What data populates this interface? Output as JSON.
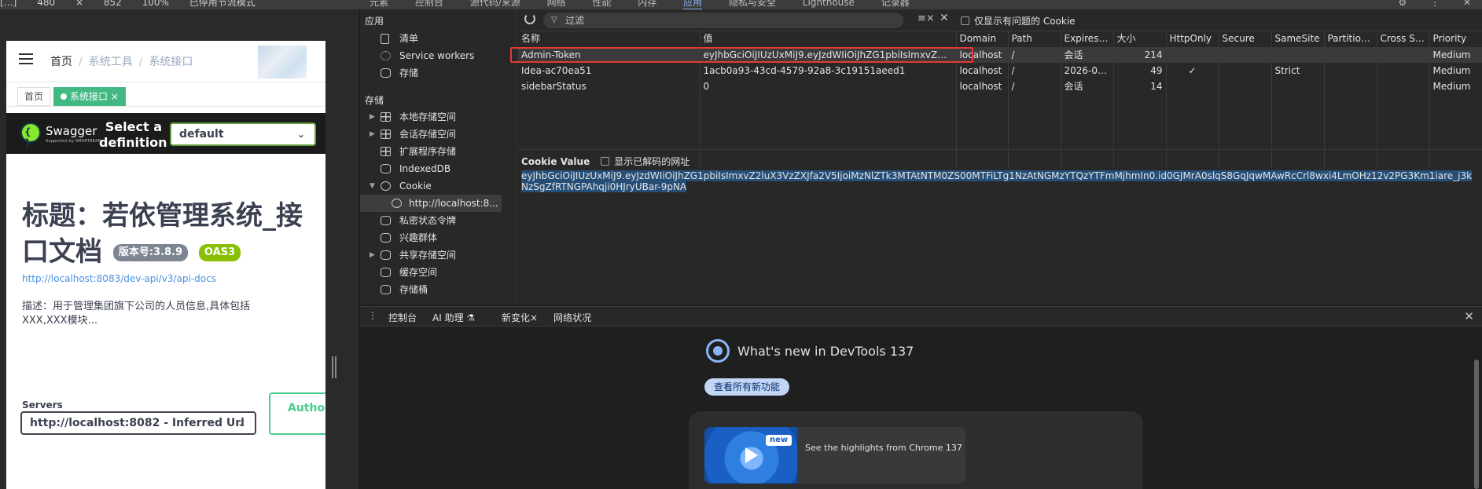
{
  "top_strip": {
    "left_items": [
      "[…]",
      "480",
      "×",
      "852",
      "100%",
      "已停用节流模式",
      "▾"
    ],
    "tabs": [
      "元素",
      "控制台",
      "源代码/来源",
      "网络",
      "性能",
      "内存",
      "应用",
      "隐私与安全",
      "Lighthouse",
      "记录器"
    ],
    "active_tab": "应用"
  },
  "page": {
    "breadcrumb": {
      "home": "首页",
      "sep": "/",
      "tools": "系统工具",
      "current": "系统接口"
    },
    "tags": {
      "home": "首页",
      "active": "系统接口",
      "close": "×"
    },
    "swagger": {
      "brand": "Swagger",
      "brand_sub": "Supported by SMARTBEAR",
      "select_label": "Select a definition",
      "select_value": "default"
    },
    "api": {
      "title": "标题：若依管理系统_接口文档",
      "version_badge": "版本号:3.8.9",
      "oas_badge": "OAS3",
      "url": "http://localhost:8083/dev-api/v3/api-docs",
      "description": "描述：用于管理集团旗下公司的人员信息,具体包括XXX,XXX模块..."
    },
    "servers": {
      "label": "Servers",
      "value": "http://localhost:8082 - Inferred Url"
    },
    "authorize_label": "Author"
  },
  "sidebar": {
    "app_heading": "应用",
    "app_items": [
      "清单",
      "Service workers",
      "存储"
    ],
    "storage_heading": "存储",
    "storage_items": [
      "本地存储空间",
      "会话存储空间",
      "扩展程序存储",
      "IndexedDB",
      "Cookie"
    ],
    "cookie_child": "http://localhost:8...",
    "more_items": [
      "私密状态令牌",
      "兴趣群体",
      "共享存储空间",
      "缓存空间",
      "存储桶"
    ]
  },
  "toolbar": {
    "filter_placeholder": "过滤",
    "only_issues_label": "仅显示有问题的 Cookie"
  },
  "cookies": {
    "columns": [
      "名称",
      "值",
      "Domain",
      "Path",
      "Expires ...",
      "大小",
      "HttpOnly",
      "Secure",
      "SameSite",
      "Partition...",
      "Cross Site",
      "Priority"
    ],
    "rows": [
      [
        "Admin-Token",
        "eyJhbGciOiJIUzUxMiJ9.eyJzdWIiOiJhZG1pbiIsImxvZ2l...",
        "localhost",
        "/",
        "会话",
        "214",
        "",
        "",
        "",
        "",
        "",
        "Medium"
      ],
      [
        "Idea-ac70ea51",
        "1acb0a93-43cd-4579-92a8-3c19151aeed1",
        "localhost",
        "/",
        "2026-06...",
        "49",
        "✓",
        "",
        "Strict",
        "",
        "",
        "Medium"
      ],
      [
        "sidebarStatus",
        "0",
        "localhost",
        "/",
        "会话",
        "14",
        "",
        "",
        "",
        "",
        "",
        "Medium"
      ]
    ]
  },
  "cookie_value": {
    "heading": "Cookie Value",
    "decode_label": "显示已解码的网址",
    "value": "eyJhbGciOiJIUzUxMiJ9.eyJzdWIiOiJhZG1pbiIsImxvZ2luX3VzZXJfa2V5IjoiMzNlZTk3MTAtNTM0ZS00MTFiLTg1NzAtNGMzYTQzYTFmMjhmIn0.id0GJMrA0slqS8GqJqwMAwRcCrl8wxi4LmOHz12v2PG3Km1iare_j3kNzSgZfRTNGPAhqji0HJryUBar-9pNA"
  },
  "drawer": {
    "tabs": [
      "控制台",
      "AI 助理",
      "新变化",
      "网络状况"
    ],
    "active_tab": "新变化",
    "whats_new_title": "What's new in DevTools 137",
    "see_all_button": "查看所有新功能",
    "card_badge": "new",
    "card_text": "See the highlights from Chrome 137"
  },
  "colors": {
    "accent": "#8ab4f8",
    "highlight": "#e53935",
    "swagger_green": "#49cc90",
    "selection": "#264f78"
  }
}
